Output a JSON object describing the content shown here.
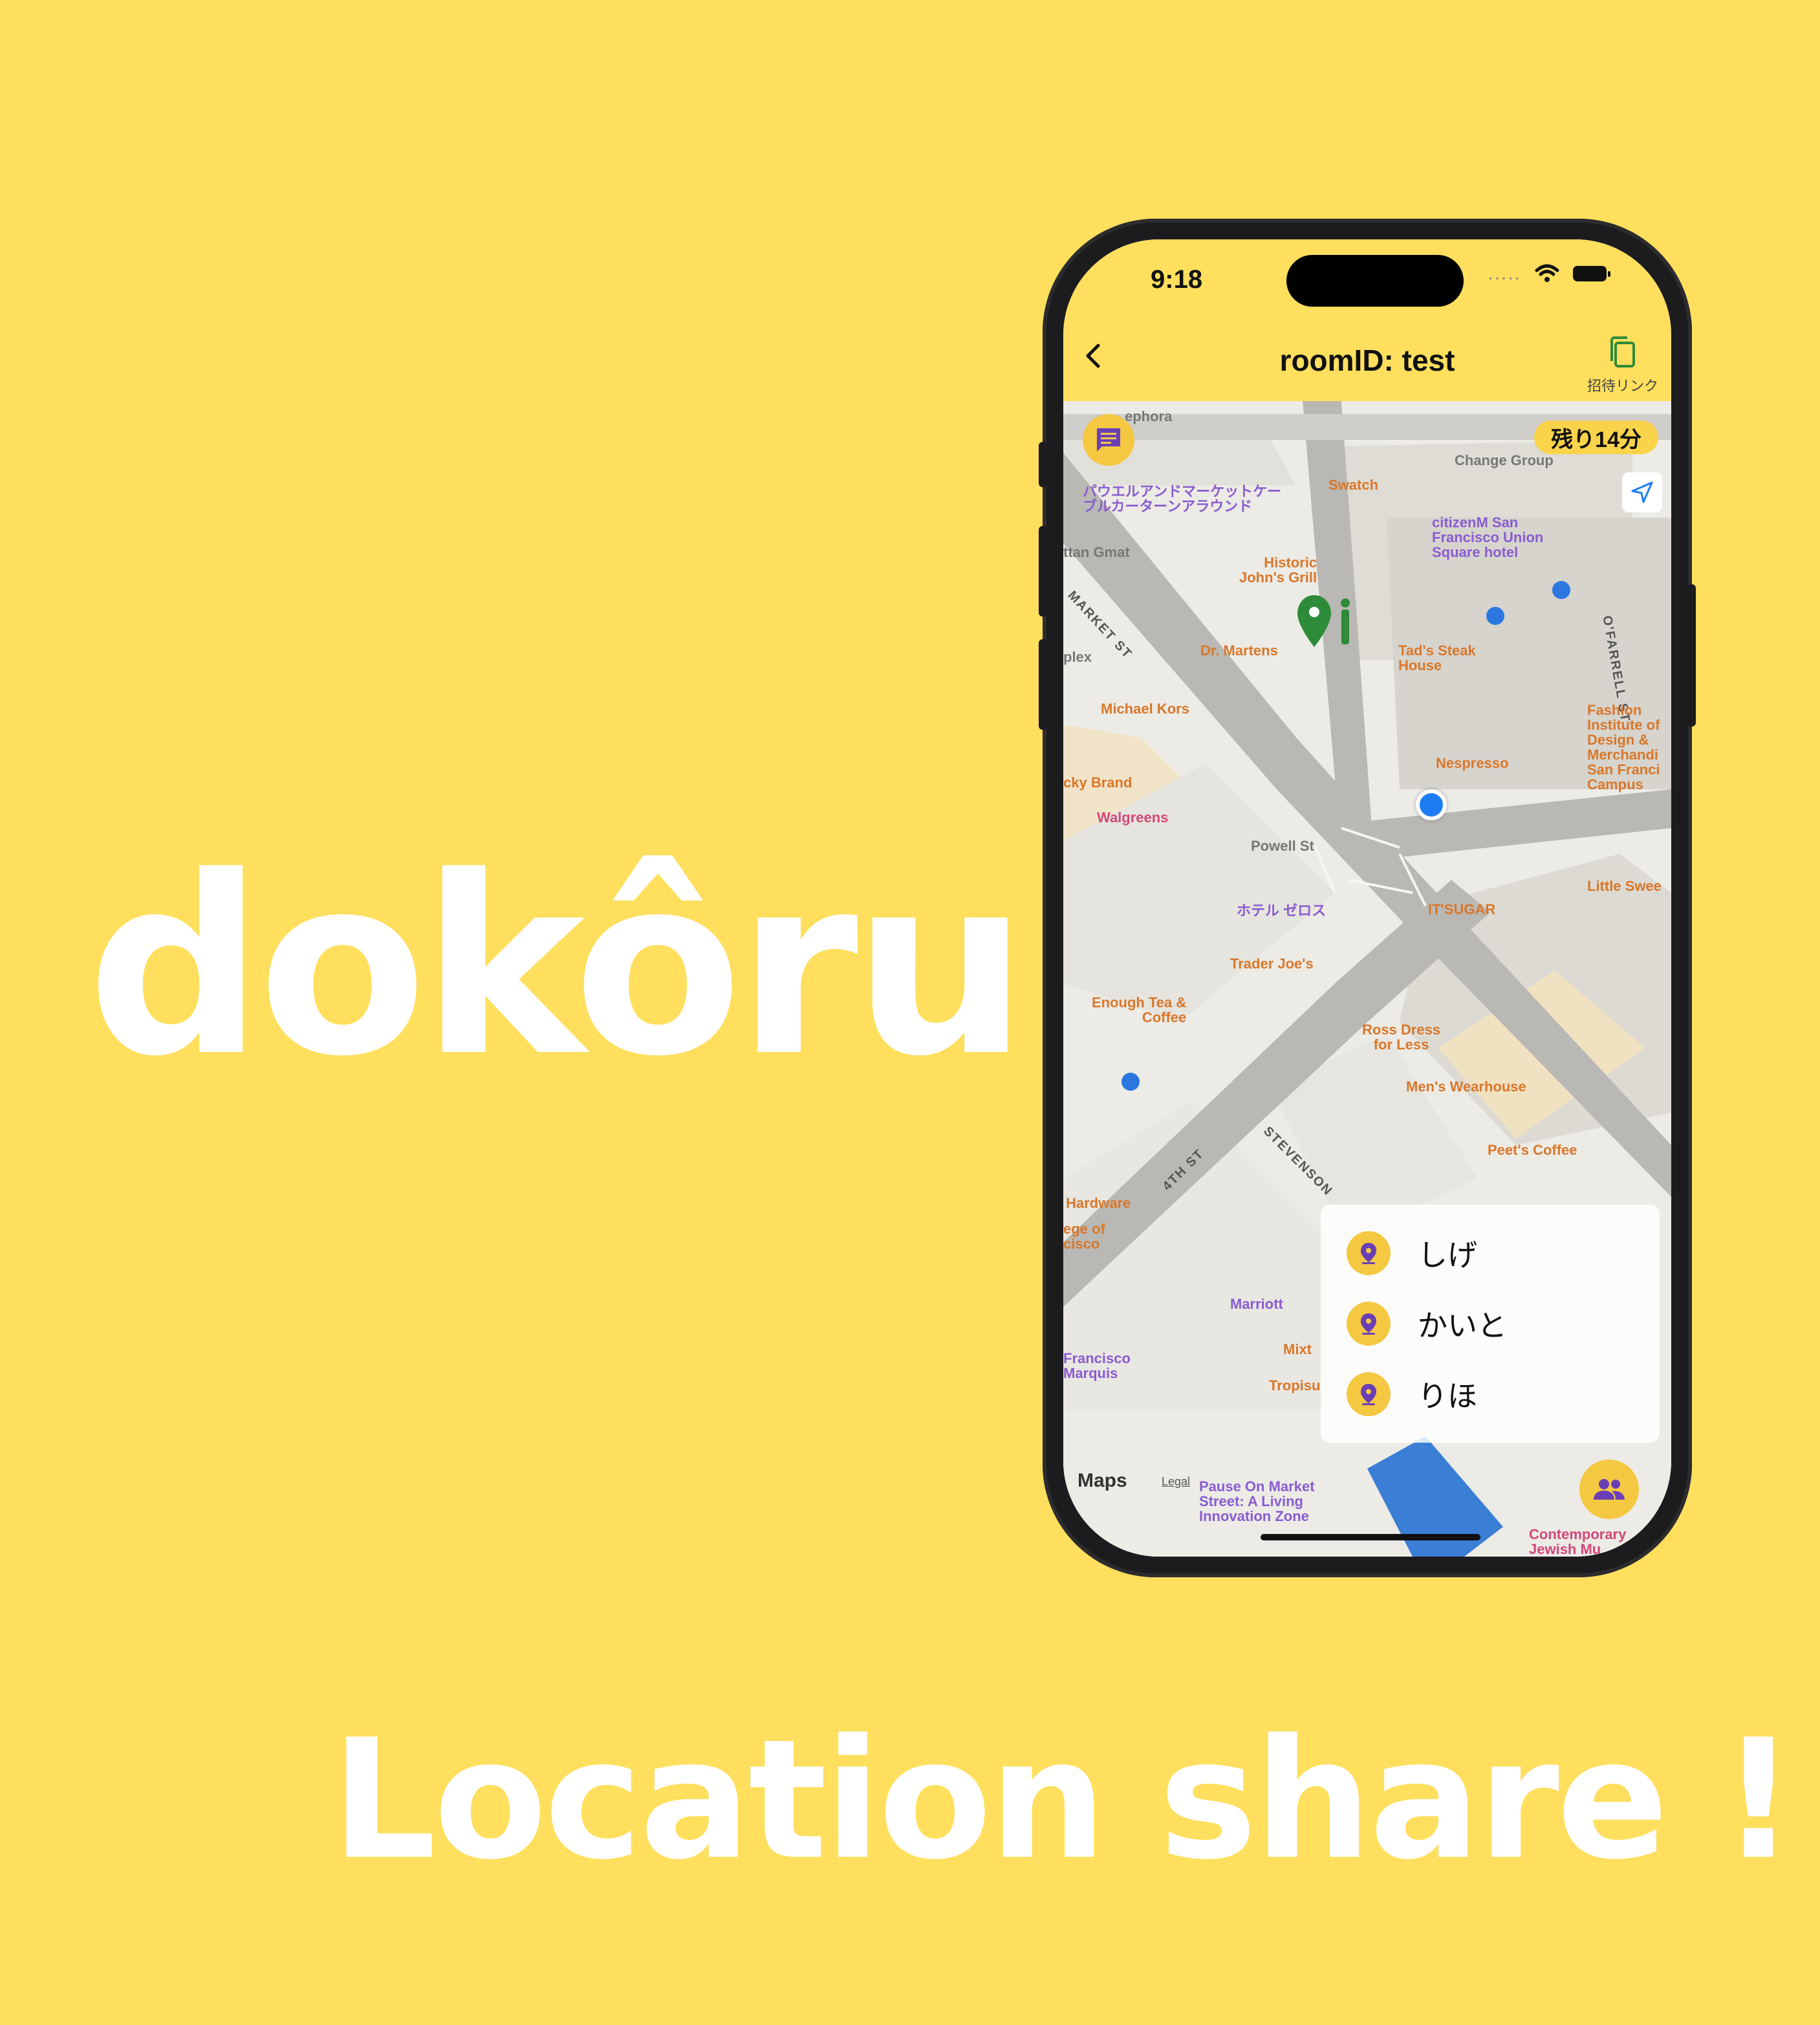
{
  "brand": "dokôru",
  "tagline": "Location share !",
  "status": {
    "time": "9:18",
    "signal": "....."
  },
  "header": {
    "title": "roomID: test",
    "invite_label": "招待リンク"
  },
  "map": {
    "remaining": "残り14分",
    "labels": [
      {
        "text": "ephora",
        "cls": "grey"
      },
      {
        "text": "Swatch",
        "cls": "orange"
      },
      {
        "text": "Change Group",
        "cls": "grey"
      },
      {
        "text": "パウエルアンドマーケットケー\nブルカーターンアラウンド",
        "cls": "purple"
      },
      {
        "text": "citizenM San\nFrancisco Union\nSquare hotel",
        "cls": "purple"
      },
      {
        "text": "ttan Gmat",
        "cls": "grey"
      },
      {
        "text": "Historic\nJohn's Grill",
        "cls": "orange"
      },
      {
        "text": "O'FARRELL ST",
        "cls": "street"
      },
      {
        "text": "MARKET ST",
        "cls": "street"
      },
      {
        "text": "plex",
        "cls": "grey"
      },
      {
        "text": "Dr. Martens",
        "cls": "orange"
      },
      {
        "text": "Tad's Steak\nHouse",
        "cls": "orange"
      },
      {
        "text": "Michael Kors",
        "cls": "orange"
      },
      {
        "text": "Fashion\nInstitute of\nDesign &\nMerchandi\nSan Franci\nCampus",
        "cls": "orange"
      },
      {
        "text": "Nespresso",
        "cls": "orange"
      },
      {
        "text": "cky Brand",
        "cls": "orange"
      },
      {
        "text": "Walgreens",
        "cls": "pink"
      },
      {
        "text": "Powell St",
        "cls": "grey"
      },
      {
        "text": "Little Swee",
        "cls": "orange"
      },
      {
        "text": "ホテル ゼロス",
        "cls": "purple"
      },
      {
        "text": "IT'SUGAR",
        "cls": "orange"
      },
      {
        "text": "Trader Joe's",
        "cls": "orange"
      },
      {
        "text": "Enough Tea &\nCoffee",
        "cls": "orange"
      },
      {
        "text": "Ross Dress\nfor Less",
        "cls": "orange"
      },
      {
        "text": "Men's Wearhouse",
        "cls": "orange"
      },
      {
        "text": "Peet's Coffee",
        "cls": "orange"
      },
      {
        "text": "4TH ST",
        "cls": "street"
      },
      {
        "text": "STEVENSON",
        "cls": "street"
      },
      {
        "text": "Hardware",
        "cls": "orange"
      },
      {
        "text": "ege of\ncisco",
        "cls": "orange"
      },
      {
        "text": "Marriott",
        "cls": "purple"
      },
      {
        "text": "Mixt",
        "cls": "orange"
      },
      {
        "text": "Francisco\nMarquis",
        "cls": "purple"
      },
      {
        "text": "Tropisu",
        "cls": "orange"
      },
      {
        "text": "Pause On Market\nStreet: A Living\nInnovation Zone",
        "cls": "purple"
      },
      {
        "text": "Contemporary\nJewish Mu",
        "cls": "pink"
      }
    ],
    "maps_logo": "Maps",
    "legal": "Legal"
  },
  "members": [
    {
      "name": "しげ"
    },
    {
      "name": "かいと"
    },
    {
      "name": "りほ"
    }
  ],
  "colors": {
    "accent": "#FFDF5D",
    "button": "#F5C842",
    "pin": "#6a3fb5",
    "user_dot": "#1e7cf2"
  }
}
